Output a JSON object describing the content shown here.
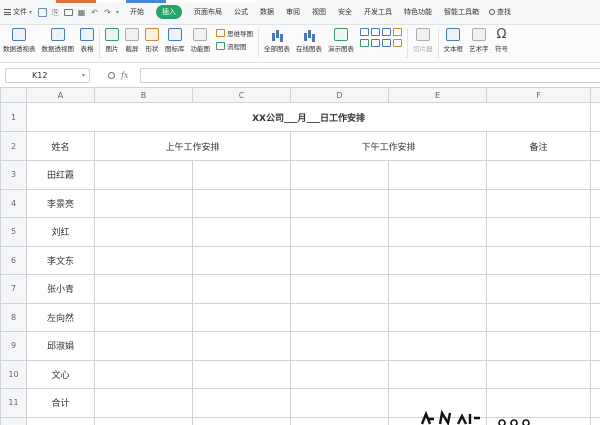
{
  "menubar": {
    "file_label": "文件",
    "tabs": [
      "开始",
      "插入",
      "页面布局",
      "公式",
      "数据",
      "审阅",
      "视图",
      "安全",
      "开发工具",
      "特色功能",
      "智能工具箱"
    ],
    "active_tab": "插入",
    "search_label": "查找"
  },
  "ribbon": {
    "items": {
      "pivot_table": "数据透视表",
      "pivot_chart": "数据透视图",
      "table": "表格",
      "picture": "图片",
      "screenshot": "截屏",
      "shape": "形状",
      "icon_lib": "图标库",
      "func_chart": "功能图",
      "mind_map": "思维导图",
      "flow_chart": "流程图",
      "all_charts": "全部图表",
      "online_chart": "在线图表",
      "demo_chart": "演示图表",
      "slicer": "切片器",
      "textbox": "文本框",
      "wordart": "艺术字",
      "symbol": "符号"
    }
  },
  "formula_bar": {
    "cell_ref": "K12",
    "fx_label": "fx",
    "formula": ""
  },
  "sheet": {
    "columns": [
      "A",
      "B",
      "C",
      "D",
      "E",
      "F"
    ],
    "rows": [
      "1",
      "2",
      "3",
      "4",
      "5",
      "6",
      "7",
      "8",
      "9",
      "10",
      "11"
    ],
    "title": "XX公司___月___日工作安排",
    "headers": {
      "name": "姓名",
      "morning": "上午工作安排",
      "afternoon": "下午工作安排",
      "notes": "备注"
    },
    "names": [
      "田红霞",
      "李景亮",
      "刘红",
      "李文东",
      "张小青",
      "左向然",
      "邱淑娟",
      "文心",
      "合计"
    ]
  }
}
